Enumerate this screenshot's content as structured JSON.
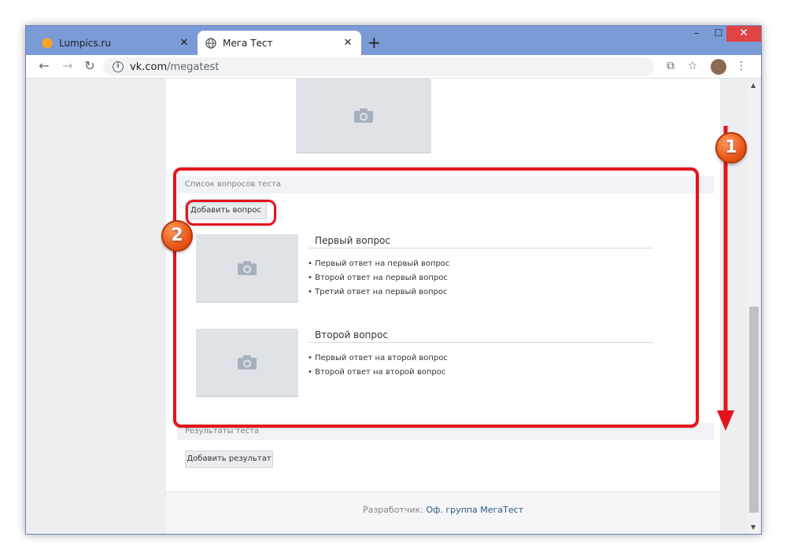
{
  "browser": {
    "tabs": [
      {
        "title": "Lumpics.ru",
        "favicon": "orange-circle-icon",
        "active": false
      },
      {
        "title": "Мега Тест",
        "favicon": "globe-icon",
        "active": true
      }
    ],
    "new_tab_label": "+",
    "window_controls": {
      "minimize": "–",
      "maximize": "☐",
      "close": "✕"
    },
    "address": {
      "domain": "vk.com",
      "path": "/megatest"
    }
  },
  "content": {
    "questions_section": {
      "header": "Список вопросов теста",
      "add_button": "Добавить вопрос",
      "questions": [
        {
          "title": "Первый вопрос",
          "answers": [
            "Первый ответ на первый вопрос",
            "Второй ответ на первый вопрос",
            "Третий ответ на первый вопрос"
          ]
        },
        {
          "title": "Второй вопрос",
          "answers": [
            "Первый ответ на второй вопрос",
            "Второй ответ на второй вопрос"
          ]
        }
      ]
    },
    "results_section": {
      "header": "Результаты теста",
      "add_button": "Добавить результат"
    },
    "footer": {
      "prefix": "Разработчик:",
      "link": "Оф. группа МегаТест"
    }
  },
  "annotations": {
    "badges": [
      "1",
      "2"
    ],
    "highlight_color": "#e4141d",
    "badge_color": "#e44f12"
  }
}
